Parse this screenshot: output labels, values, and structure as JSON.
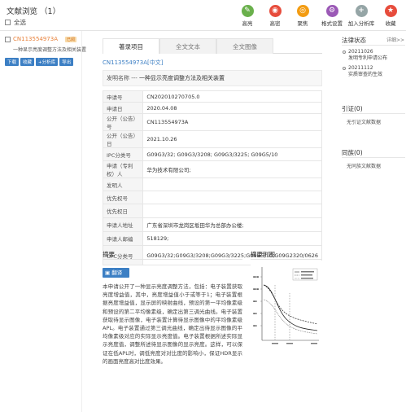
{
  "header": {
    "title": "文献浏览 （1）",
    "select_all": "全选"
  },
  "toolbar": [
    {
      "label": "高亮",
      "icon": "highlight-icon",
      "color": "#6ab04c",
      "glyph": "✎"
    },
    {
      "label": "高密",
      "icon": "density-icon",
      "color": "#e74c3c",
      "glyph": "◉"
    },
    {
      "label": "聚焦",
      "icon": "focus-icon",
      "color": "#f39c12",
      "glyph": "◎"
    },
    {
      "label": "格式设置",
      "icon": "format-settings-icon",
      "color": "#9b59b6",
      "glyph": "⚙"
    },
    {
      "label": "加入分析库",
      "icon": "add-library-icon",
      "color": "#95a5a6",
      "glyph": "+"
    },
    {
      "label": "收藏",
      "icon": "favorite-icon",
      "color": "#e74c3c",
      "glyph": "★"
    }
  ],
  "left_list": {
    "number": "CN113554973A",
    "badge": "已阅",
    "subtitle": "一种显示亮度调整方法及相关装置",
    "buttons": [
      "下载",
      "收藏",
      "+分析库",
      "导出"
    ]
  },
  "tabs": [
    "著录项目",
    "全文文本",
    "全文图像"
  ],
  "doc": {
    "number": "CN113554973A[中文]",
    "invention_label": "发明名称 ---",
    "invention_title": "一种显示亮度调整方法及相关装置"
  },
  "meta_rows": [
    {
      "k": "申请号",
      "v": "CN202010270705.0"
    },
    {
      "k": "申请日",
      "v": "2020.04.08"
    },
    {
      "k": "公开（公告）号",
      "v": "CN113554973A"
    },
    {
      "k": "公开（公告）日",
      "v": "2021.10.26"
    },
    {
      "k": "IPC分类号",
      "v": "G09G3/32; G09G3/3208; G09G3/3225; G09G5/10"
    },
    {
      "k": "申请（专利权）人",
      "v": "华为技术有限公司;"
    },
    {
      "k": "发明人",
      "v": ""
    },
    {
      "k": "优先权号",
      "v": ""
    },
    {
      "k": "优先权日",
      "v": ""
    },
    {
      "k": "申请人地址",
      "v": "广东省深圳市龙岗区坂田华为总部办公楼;"
    },
    {
      "k": "申请人邮编",
      "v": "518129;"
    },
    {
      "k": "CPC分类号",
      "v": "G09G3/32;G09G3/3208;G09G3/3225;G09G5/10;G09G2320/0626"
    }
  ],
  "abstract": {
    "title": "摘要",
    "translate": "翻译",
    "text": "本申请公开了一种显示亮度调整方法，包括：电子装置获取亮度增益值，其中，亮度增益值小于或等于1；电子装置根据亮度增益值，显示屏的映射曲线，预设的第一平均像素级和预设的第二平均像素级，确定出第三调光曲线。电子装置获取待显示图像，电子装置计算待显示图像中的平均像素级APL。电子装置通过第三调光曲线，确定出待显示图像的平均像素级对应的实际显示亮度值。电子装置根据所述实际显示亮度值，调整所述待显示图像的显示亮度。这样，可以保证在低APL时，调低亮度对对比度的影响小，保证HDR显示的画面亮度高对比度效果。"
  },
  "figure": {
    "title": "摘要附图"
  },
  "right": {
    "legal_title": "法律状态",
    "more": "详细>>",
    "timeline": [
      {
        "date": "20211026",
        "text": "发明专利申请公布"
      },
      {
        "date": "20211112",
        "text": "实质审查的生效"
      }
    ],
    "cite_title": "引证(0)",
    "cite_text": "无引证文献数据",
    "same_title": "同族(0)",
    "same_text": "无同族文献数据"
  }
}
